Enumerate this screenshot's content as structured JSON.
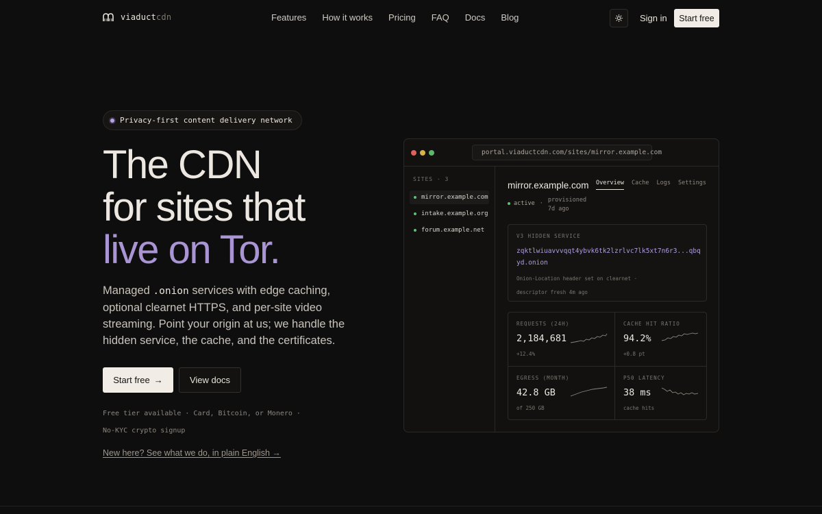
{
  "nav": {
    "brand_main": "viaduct",
    "brand_suffix": "cdn",
    "links": [
      "Features",
      "How it works",
      "Pricing",
      "FAQ",
      "Docs",
      "Blog"
    ],
    "theme_icon": "sun-icon",
    "signin": "Sign in",
    "start": "Start free"
  },
  "hero": {
    "badge": "Privacy-first content delivery network",
    "title_line1": "The CDN",
    "title_line2": "for sites that",
    "title_line3": "live on Tor.",
    "lede_part1": "Managed ",
    "lede_code": ".onion",
    "lede_part2": " services with edge caching, optional clearnet HTTPS, and per-site video streaming. Point your origin at us; we handle the hidden service, the cache, and the certificates.",
    "primary_cta": "Start free",
    "primary_cta_arrow": "→",
    "secondary_cta": "View docs",
    "fine1": "Free tier available",
    "fine_sep": "·",
    "fine2": "Card, Bitcoin, or Monero",
    "fine3": "No-KYC crypto signup",
    "plain_link": "New here? See what we do, in plain English →"
  },
  "portal": {
    "url": "portal.viaductcdn.com/sites/mirror.example.com",
    "sites_header": "SITES · 3",
    "sites": [
      "mirror.example.com",
      "intake.example.org",
      "forum.example.net"
    ],
    "site_title": "mirror.example.com",
    "tabs": [
      "Overview",
      "Cache",
      "Logs",
      "Settings"
    ],
    "status": "active",
    "status_sep": "·",
    "provisioned_line1": "provisioned",
    "provisioned_line2": "7d ago",
    "hidden_service_label": "V3 HIDDEN SERVICE",
    "onion_address": "zqktlwiuavvvqqt4ybvk6tk2lzrlvc7lk5xt7n6r3...qbqyd.onion",
    "hs_meta1": "Onion-Location header set on clearnet  ·",
    "hs_meta2": "descriptor fresh 4m ago",
    "stats": [
      {
        "label": "REQUESTS (24H)",
        "value": "2,184,681",
        "sub": "+12.4%"
      },
      {
        "label": "CACHE HIT RATIO",
        "value": "94.2%",
        "sub": "+0.8 pt"
      },
      {
        "label": "EGRESS (MONTH)",
        "value": "42.8 GB",
        "sub": "of 250 GB"
      },
      {
        "label": "P50 LATENCY",
        "value": "38 ms",
        "sub": "cache hits"
      }
    ],
    "colors": {
      "accent": "#a994d4",
      "status_green": "#5cc07a",
      "traffic_red": "#e0605a",
      "traffic_yellow": "#d9b24a",
      "traffic_green": "#5cb96c"
    }
  }
}
